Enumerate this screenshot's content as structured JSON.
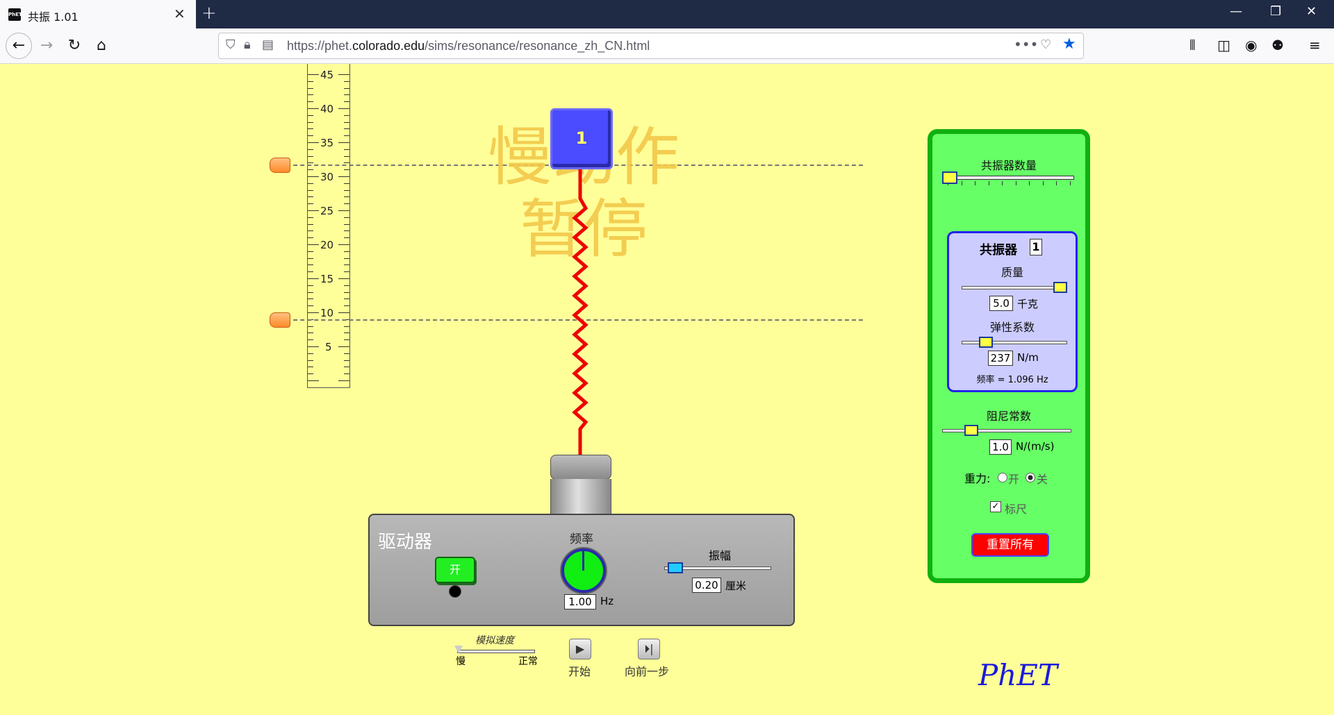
{
  "browser": {
    "tab_title": "共振 1.01",
    "favicon_text": "PhET",
    "new_tab": "+",
    "url_prefix": "https://phet.",
    "url_domain": "colorado.edu",
    "url_suffix": "/sims/resonance/resonance_zh_CN.html"
  },
  "ruler": {
    "labels": [
      "45",
      "40",
      "35",
      "30",
      "25",
      "20",
      "15",
      "10",
      "5"
    ]
  },
  "watermark": {
    "line1": "慢动作",
    "line2": "暂停"
  },
  "mass_block": {
    "label": "1"
  },
  "driver": {
    "title": "驱动器",
    "on_button": "开",
    "frequency_label": "频率",
    "frequency_value": "1.00",
    "frequency_unit": "Hz",
    "amplitude_label": "振幅",
    "amplitude_value": "0.20",
    "amplitude_unit": "厘米",
    "amplitude_level": 0.05
  },
  "playback": {
    "speed_label": "模拟速度",
    "speed_slow": "慢",
    "speed_normal": "正常",
    "play_label": "开始",
    "step_label": "向前一步",
    "speed_level": 0.0
  },
  "panel": {
    "resonator_count_label": "共振器数量",
    "resonator_count_level": 0.0,
    "resonator_title": "共振器",
    "resonator_number": "1",
    "mass_label": "质量",
    "mass_value": "5.0",
    "mass_unit": "千克",
    "mass_level": 1.0,
    "spring_label": "弹性系数",
    "spring_value": "237",
    "spring_unit": "N/m",
    "spring_level": 0.2,
    "frequency_text": "频率 = 1.096 Hz",
    "damping_label": "阻尼常数",
    "damping_value": "1.0",
    "damping_unit": "N/(m/s)",
    "damping_level": 0.2,
    "gravity_label": "重力:",
    "gravity_on": "开",
    "gravity_off": "关",
    "gravity_selected": "关",
    "ruler_label": "标尺",
    "ruler_checked": true,
    "reset_button": "重置所有"
  },
  "logo": "PhET",
  "colors": {
    "background": "#ffff99",
    "panel": "#66ff66",
    "spring": "#ee0000",
    "mass": "#4b4bff",
    "reset": "#ff0000"
  }
}
